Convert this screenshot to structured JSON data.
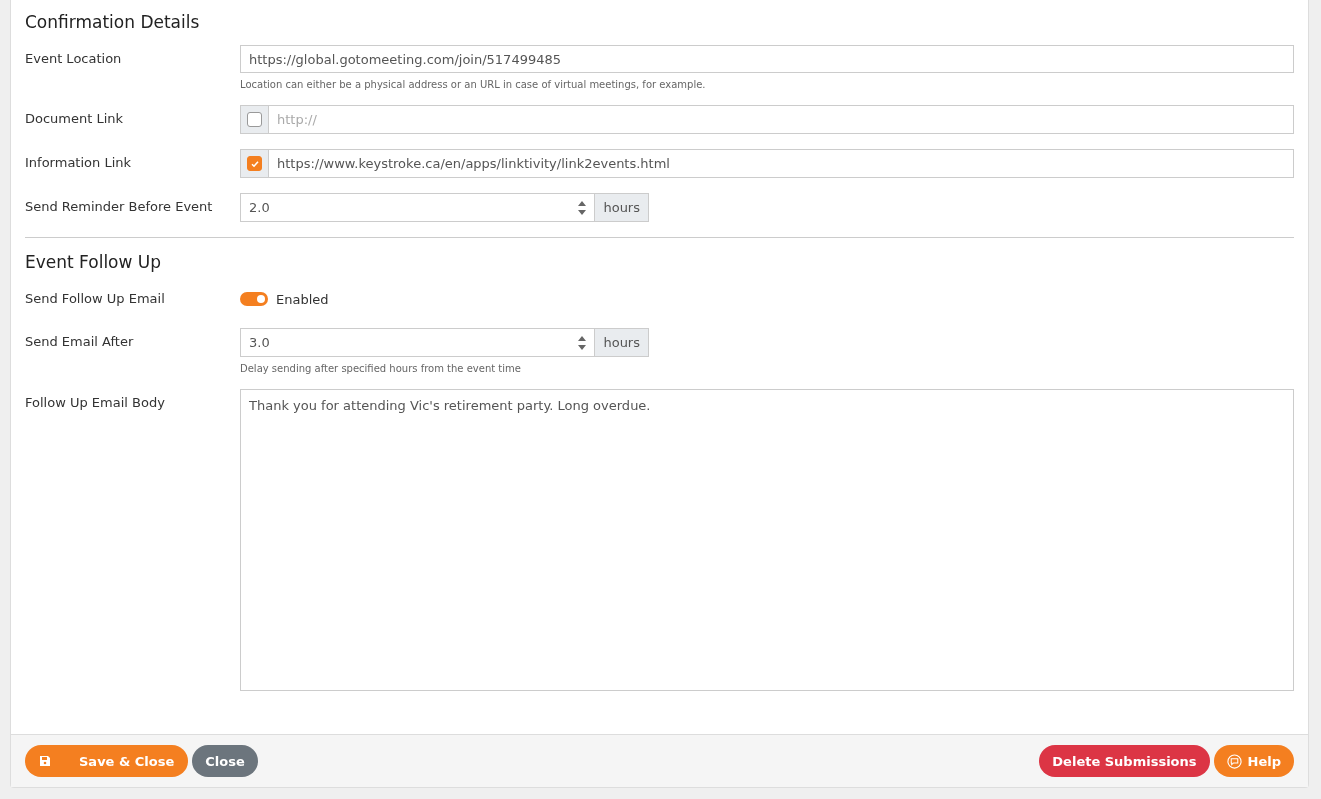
{
  "sections": [
    {
      "title": "Confirmation Details",
      "fields": [
        {
          "kind": "text",
          "label": "Event Location",
          "value": "https://global.gotomeeting.com/join/517499485",
          "help": "Location can either be a physical address or an URL in case of virtual meetings, for example."
        },
        {
          "kind": "checked-link",
          "label": "Document Link",
          "checked": false,
          "placeholder": "http://"
        },
        {
          "kind": "checked-link",
          "label": "Information Link",
          "checked": true,
          "value": "https://www.keystroke.ca/en/apps/linktivity/link2events.html"
        },
        {
          "kind": "number",
          "label": "Send Reminder Before Event",
          "value": "2.0",
          "unit": "hours"
        }
      ]
    },
    {
      "title": "Event Follow Up",
      "fields": [
        {
          "kind": "toggle",
          "label": "Send Follow Up Email",
          "on": true,
          "text": "Enabled"
        },
        {
          "kind": "number",
          "label": "Send Email After",
          "value": "3.0",
          "unit": "hours",
          "help": "Delay sending after specified hours from the event time"
        },
        {
          "kind": "textarea",
          "label": "Follow Up Email Body",
          "value": "Thank you for attending Vic's retirement party. Long overdue."
        }
      ]
    }
  ],
  "footer": {
    "left": [
      {
        "kind": "save",
        "label": "Save & Close"
      },
      {
        "kind": "close",
        "label": "Close"
      }
    ],
    "right": [
      {
        "kind": "delete",
        "label": "Delete Submissions"
      },
      {
        "kind": "help",
        "label": "Help"
      }
    ]
  }
}
